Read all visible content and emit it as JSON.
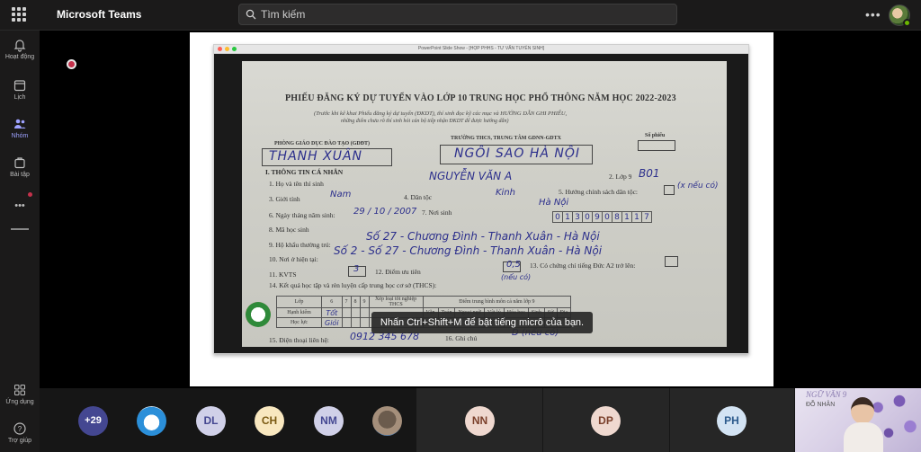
{
  "app": {
    "title": "Microsoft Teams"
  },
  "search": {
    "placeholder": "Tìm kiếm"
  },
  "header": {
    "more_label": "•••"
  },
  "rail": {
    "items": [
      {
        "label": "Hoạt động",
        "icon": "bell-icon"
      },
      {
        "label": "Lịch",
        "icon": "calendar-icon"
      },
      {
        "label": "Nhóm",
        "icon": "teams-icon"
      },
      {
        "label": "Bài tập",
        "icon": "assignments-icon"
      },
      {
        "label": "•••",
        "icon": "more-icon"
      },
      {
        "label": "Ứng dụng",
        "icon": "apps-icon"
      },
      {
        "label": "Trợ giúp",
        "icon": "help-icon"
      }
    ]
  },
  "share": {
    "window_title": "PowerPoint Slide Show - [HỌP PHHS - TƯ VẤN TUYỂN SINH]",
    "form": {
      "title": "PHIẾU ĐĂNG KÝ DỰ TUYỂN VÀO LỚP 10 TRUNG HỌC PHỔ THÔNG NĂM HỌC 2022-2023",
      "subtitle": "(Trước khi kê khai Phiếu đăng ký dự tuyển (ĐKDT), thí sinh đọc kỹ các mục và HƯỚNG DẪN GHI PHIẾU,",
      "subtitle2": "những điểm chưa rõ thí sinh hỏi cán bộ tiếp nhận ĐKDT để được hướng dẫn)",
      "dept_label": "PHÒNG GIÁO DỤC ĐÀO TẠO (GDĐT)",
      "school_label": "TRƯỜNG THCS, TRUNG TÂM GDNN-GDTX",
      "number_label": "Số phiếu",
      "dept_value": "THANH XUÂN",
      "school_value": "NGÔI SAO HÀ NỘI",
      "section1": "I. THÔNG TIN CÁ NHÂN",
      "f1": "1. Họ và tên thí sinh",
      "f1_value": "NGUYỄN VĂN A",
      "f2": "2. Lớp 9",
      "f2_value": "B01",
      "f3": "3. Giới tính",
      "f3_value": "Nam",
      "f4": "4. Dân tộc",
      "f4_value": "Kinh",
      "f5": "5. Hưởng chính sách dân tộc:",
      "f5_note": "(x nếu có)",
      "f6": "6. Ngày tháng năm sinh:",
      "f6_value": "29 / 10 / 2007",
      "f7": "7. Nơi sinh",
      "f7_value": "Hà Nội",
      "f8": "8. Mã học sinh",
      "f8_digits": [
        "0",
        "1",
        "3",
        "0",
        "9",
        "0",
        "8",
        "1",
        "1",
        "7"
      ],
      "f9": "9. Hộ khẩu thường trú:",
      "f9_value": "Số 27 - Chương Đình - Thanh Xuân - Hà Nội",
      "f10": "10. Nơi ở hiện tại:",
      "f10_value": "Số 2 - Số 27 - Chương Đình - Thanh Xuân - Hà Nội",
      "f11": "11. KVTS",
      "f11_value": "3",
      "f12": "12. Điểm ưu tiên",
      "f12_value": "0,5",
      "f12_note": "(nếu có)",
      "f13": "13. Có chứng chỉ tiếng Đức A2 trở lên:",
      "f14": "14. Kết quả học tập và rèn luyện cấp trung học cơ sở (THCS):",
      "table_headers": [
        "Lớp",
        "6",
        "7",
        "8",
        "9",
        "Xếp loại tốt nghiệp THCS"
      ],
      "table_subheader": "Điểm trung bình môn cả năm lớp 9",
      "subject_headers": [
        "Văn",
        "Toán",
        "Ngoại ngữ",
        "Vật lý",
        "Hóa học",
        "Sinh",
        "Sử",
        "Địa"
      ],
      "row1": "Hạnh kiểm",
      "row1_value": "Tốt",
      "row2": "Học lực",
      "row2_value": "Giỏi",
      "f15": "15. Điện thoại liên hệ:",
      "f15_value": "0912 345 678",
      "f16": "16. Ghi chú",
      "f16_value": "D (nếu có)"
    }
  },
  "toast": {
    "text": "Nhấn Ctrl+Shift+M để bật tiếng micrô của bạn."
  },
  "participants": [
    {
      "initials": "+29"
    },
    {
      "initials": ""
    },
    {
      "initials": "DL",
      "color": "#d0d0e8",
      "text_color": "#444791"
    },
    {
      "initials": "CH",
      "color": "#f8e7bf",
      "text_color": "#7a5a13"
    },
    {
      "initials": "NM",
      "color": "#d0d0e8",
      "text_color": "#444791"
    },
    {
      "initials": ""
    },
    {
      "initials": "NN",
      "color": "#efd8cf",
      "text_color": "#7a3f2a"
    },
    {
      "initials": "DP",
      "color": "#efd8cf",
      "text_color": "#7a3f2a"
    },
    {
      "initials": "PH",
      "color": "#d3e3f3",
      "text_color": "#2c5a8c"
    }
  ],
  "camera": {
    "caption1": "NGỮ VĂN 9",
    "caption2": "ĐỖ NHÂN"
  }
}
